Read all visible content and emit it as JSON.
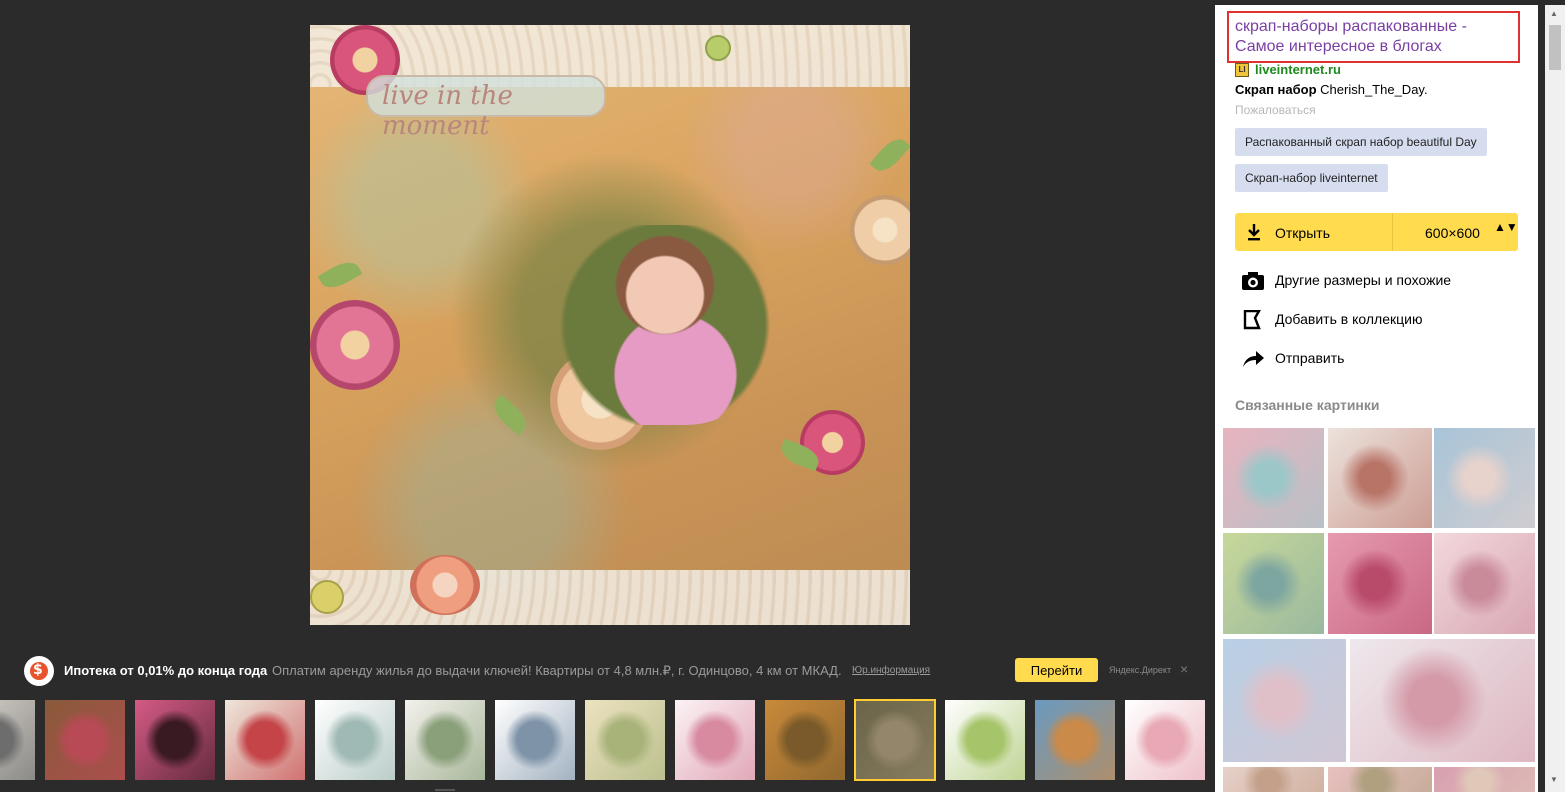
{
  "viewer": {
    "image_text": "live in the moment"
  },
  "ad": {
    "title": "Ипотека от 0,01% до конца года",
    "text": "Оплатим аренду жилья до выдачи ключей! Квартиры от 4,8 млн.₽, г. Одинцово, 4 км от МКАД.",
    "legal": "Юр.информация",
    "button": "Перейти",
    "brand": "Яндекс.Директ",
    "close": "×"
  },
  "thumbnails": [
    {
      "colors": [
        "#d9d4cc",
        "#6d6d6d"
      ]
    },
    {
      "colors": [
        "#8a5a3a",
        "#b84a55"
      ]
    },
    {
      "colors": [
        "#d45a86",
        "#3a1a22"
      ]
    },
    {
      "colors": [
        "#eee6da",
        "#c44448"
      ]
    },
    {
      "colors": [
        "#ffffff",
        "#9fb9b4"
      ]
    },
    {
      "colors": [
        "#f3f1ec",
        "#8aa07a"
      ]
    },
    {
      "colors": [
        "#ffffff",
        "#7e93a8"
      ]
    },
    {
      "colors": [
        "#ece2c0",
        "#a8b37a"
      ]
    },
    {
      "colors": [
        "#fbf2f4",
        "#d78aa0"
      ]
    },
    {
      "colors": [
        "#c98a3a",
        "#7a5a2a"
      ]
    },
    {
      "colors": [
        "#6a6448",
        "#93866a"
      ],
      "active": true
    },
    {
      "colors": [
        "#ffffff",
        "#a6c46a"
      ]
    },
    {
      "colors": [
        "#6a9ac0",
        "#c98a4a"
      ]
    },
    {
      "colors": [
        "#ffffff",
        "#e8a8b4"
      ]
    }
  ],
  "panel": {
    "title": "скрап-наборы распакованные - Самое интересное в блогах",
    "source_icon": "LI",
    "source": "liveinternet.ru",
    "desc_bold": "Скрап набор",
    "desc_rest": " Cherish_The_Day.",
    "complain": "Пожаловаться",
    "tags": [
      "Распакованный скрап набор beautiful Day",
      "Скрап-набор liveinternet"
    ],
    "open": {
      "label": "Открыть",
      "size": "600×600",
      "arrows": "▲▼"
    },
    "actions": [
      {
        "icon": "camera-icon",
        "label": "Другие размеры и похожие"
      },
      {
        "icon": "collection-icon",
        "label": "Добавить в коллекцию"
      },
      {
        "icon": "share-icon",
        "label": "Отправить"
      }
    ],
    "related_title": "Связанные картинки",
    "related": [
      {
        "colors": [
          "#e8b4c0",
          "#9cc7c9"
        ]
      },
      {
        "colors": [
          "#ece2dc",
          "#b97468"
        ]
      },
      {
        "colors": [
          "#a8c4d8",
          "#e7d2cc"
        ]
      },
      {
        "colors": [
          "#c8d89a",
          "#7ea6a0"
        ]
      },
      {
        "colors": [
          "#e69ab0",
          "#b84a6a"
        ]
      },
      {
        "colors": [
          "#f2d8dc",
          "#c98a9a"
        ]
      },
      {
        "colors": [
          "#b8d0e6",
          "#e0c0c8"
        ]
      },
      {
        "colors": [
          "#eee8ec",
          "#d49aa8"
        ]
      },
      {
        "colors": [
          "#e6d0c8",
          "#c4a08a"
        ]
      },
      {
        "colors": [
          "#e8c0c0",
          "#b0a080"
        ]
      },
      {
        "colors": [
          "#d8a0b0",
          "#e0c8b8"
        ]
      }
    ]
  },
  "scrollbar": {
    "up": "▲",
    "down": "▼"
  }
}
